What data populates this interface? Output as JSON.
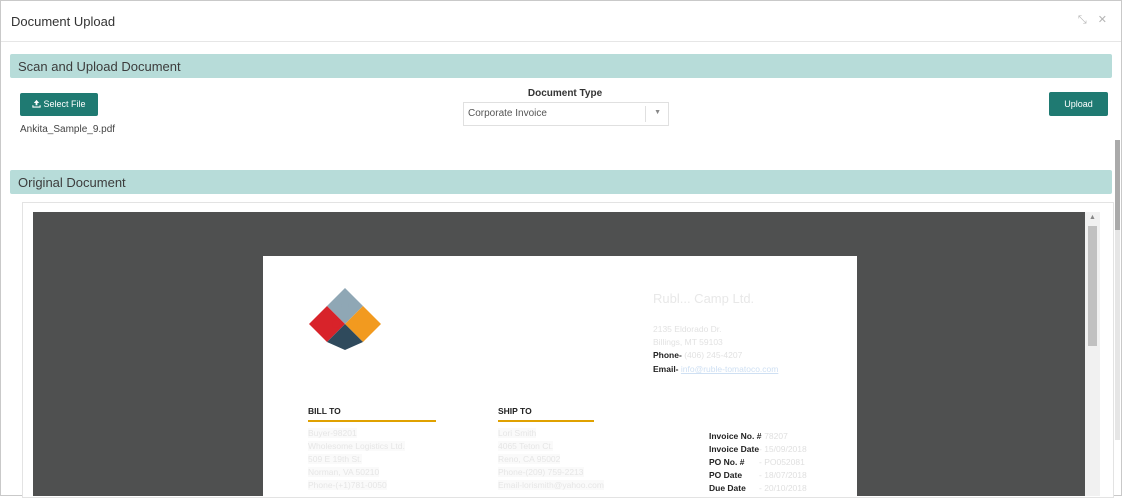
{
  "window": {
    "title": "Document Upload",
    "minimize_glyph": "⤡",
    "close_glyph": "✕"
  },
  "scan_section": {
    "heading": "Scan and Upload Document",
    "select_file_label": "Select File",
    "select_file_icon": "upload-icon",
    "file_name": "Ankita_Sample_9.pdf",
    "document_type_label": "Document Type",
    "document_type_value": "Corporate Invoice",
    "upload_label": "Upload"
  },
  "original_section": {
    "heading": "Original Document",
    "document": {
      "company_name": "Rubl... Camp Ltd.",
      "address_line1": "2135 Eldorado Dr.",
      "address_line2": "Billings, MT 59103",
      "phone_label": "Phone-",
      "phone_value": "(406) 245-4207",
      "email_label": "Email-",
      "email_value": "info@ruble-tomatoco.com",
      "bill_to": {
        "heading": "BILL TO",
        "lines": [
          "Buyer-98201",
          "Wholesome Logistics Ltd.",
          "509 E 19th St.",
          "Norman, VA 50210",
          "Phone-(+1)781-0050"
        ]
      },
      "ship_to": {
        "heading": "SHIP TO",
        "lines": [
          "Lori Smith",
          "4065 Teton Ct.",
          "Reno, CA 95002",
          "Phone-(209) 759-2213",
          "Email-lorismith@yahoo.com"
        ]
      },
      "invoice_fields": [
        {
          "label": "Invoice No. #",
          "value": "- 78207"
        },
        {
          "label": "Invoice Date",
          "value": "- 15/09/2018"
        },
        {
          "label": "PO No. #",
          "value": "- PO052081"
        },
        {
          "label": "PO Date",
          "value": "- 18/07/2018"
        },
        {
          "label": "Due Date",
          "value": "- 20/10/2018"
        }
      ]
    }
  },
  "colors": {
    "accent": "#1f7a72",
    "section_header_bg": "#b7dcd9",
    "viewer_bg": "#4f5050",
    "rule_gold": "#e0a100"
  }
}
